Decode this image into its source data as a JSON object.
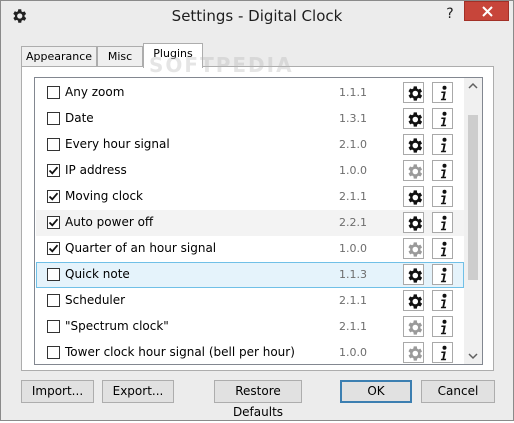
{
  "window": {
    "title": "Settings - Digital Clock",
    "help_label": "?"
  },
  "watermark": "SOFTPEDIA",
  "tabs": [
    {
      "label": "Appearance",
      "active": false
    },
    {
      "label": "Misc",
      "active": false
    },
    {
      "label": "Plugins",
      "active": true
    }
  ],
  "plugins": [
    {
      "name": "Any zoom",
      "version": "1.1.1",
      "checked": false,
      "configurable": true
    },
    {
      "name": "Date",
      "version": "1.3.1",
      "checked": false,
      "configurable": true
    },
    {
      "name": "Every hour signal",
      "version": "2.1.0",
      "checked": false,
      "configurable": true
    },
    {
      "name": "IP address",
      "version": "1.0.0",
      "checked": true,
      "configurable": false
    },
    {
      "name": "Moving clock",
      "version": "2.1.1",
      "checked": true,
      "configurable": true
    },
    {
      "name": "Auto power off",
      "version": "2.2.1",
      "checked": true,
      "configurable": true
    },
    {
      "name": "Quarter of an hour signal",
      "version": "1.0.0",
      "checked": true,
      "configurable": false
    },
    {
      "name": "Quick note",
      "version": "1.1.3",
      "checked": false,
      "configurable": true
    },
    {
      "name": "Scheduler",
      "version": "2.1.1",
      "checked": false,
      "configurable": true
    },
    {
      "name": "\"Spectrum clock\"",
      "version": "2.1.1",
      "checked": false,
      "configurable": false
    },
    {
      "name": "Tower clock hour signal (bell per hour)",
      "version": "1.0.0",
      "checked": false,
      "configurable": false
    }
  ],
  "buttons": {
    "import": "Import...",
    "export": "Export...",
    "restore": "Restore Defaults",
    "ok": "OK",
    "cancel": "Cancel"
  },
  "colors": {
    "highlight_bg": "#e5f3fb",
    "highlight_border": "#70c0e7",
    "close_button": "#c7453a",
    "default_button_border": "#3c7fb1"
  },
  "icons": {
    "settings": "gear-icon",
    "info": "info-icon",
    "checkbox": "checkmark-icon"
  }
}
